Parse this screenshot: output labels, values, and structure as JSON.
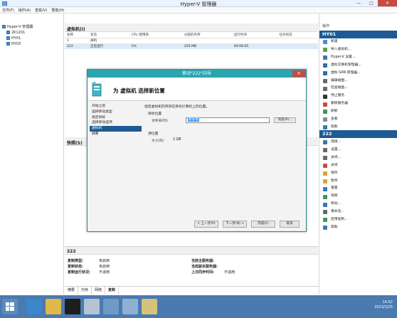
{
  "window": {
    "title": "Hyper-V 管理器",
    "min": "—",
    "max": "□",
    "close": "✕"
  },
  "menu": [
    "文件(F)",
    "操作(A)",
    "查看(V)",
    "帮助(H)"
  ],
  "tree": {
    "root": "Hyper-V 管理器",
    "hosts": [
      "2K1201",
      "HY01",
      "HY03"
    ]
  },
  "vms": {
    "title": "虚拟机(I)",
    "columns": [
      "名称",
      "状态",
      "CPU 使用率",
      "分配的内存",
      "运行时间",
      "任务状态"
    ],
    "rows": [
      [
        "1",
        "关机",
        "",
        "",
        "",
        ""
      ],
      [
        "222",
        "正在运行",
        "1%",
        "256 MB",
        "00:08:05",
        ""
      ]
    ]
  },
  "snapshots": {
    "title": "快照(S)"
  },
  "details": {
    "title": "222",
    "left_keys": [
      "复制类型:",
      "复制状态:",
      "复制运行状况:"
    ],
    "left_values": [
      "未启用",
      "未启用",
      "不适用"
    ],
    "right_keys": [
      "当前主服务器:",
      "当前副本服务器:",
      "上次同步时间:"
    ],
    "right_values": [
      "",
      "",
      "不适用"
    ],
    "tabs": [
      "摘要",
      "内存",
      "网络",
      "复制"
    ]
  },
  "actions": {
    "title": "操作",
    "host_section": "HY01",
    "host_items": [
      "新建",
      "导入虚拟机...",
      "Hyper-V 设置...",
      "虚拟交换机管理器...",
      "虚拟 SAN 管理器...",
      "编辑磁盘...",
      "检查磁盘...",
      "停止服务",
      "删除服务器",
      "刷新",
      "查看",
      "帮助"
    ],
    "vm_section": "222",
    "vm_items": [
      "连接...",
      "设置...",
      "关闭...",
      "关闭",
      "保存",
      "暂停",
      "重置",
      "快照",
      "移动...",
      "重命名...",
      "启用复制...",
      "帮助"
    ]
  },
  "wizard": {
    "title": "移动\"222\"向导",
    "close": "✕",
    "heading": "为 虚拟机 选择新位置",
    "steps": [
      "开始之前",
      "选择移动类型",
      "指定目标",
      "选择移动选项",
      "虚拟机",
      "摘要"
    ],
    "current_step": 4,
    "instruction": "指定虚拟机的项目在目标计算机上的位置。",
    "target_label": "目标位置",
    "folder_label": "文件夹(O):",
    "folder_value": "新加卷",
    "browse": "浏览(R)...",
    "source_label": "源位置",
    "size_label": "大小(S):",
    "size_value": "2 GB",
    "buttons": {
      "prev": "< 上一步(P)",
      "next": "下一步(N) >",
      "finish": "完成(F)",
      "cancel": "取消"
    }
  },
  "taskbar": {
    "time": "14:52",
    "date": "2013/3/25"
  },
  "colors": {
    "wizard_title": "#29a6b0",
    "section_blue": "#1e5a94",
    "taskbar": "#4a7ab0",
    "close_red": "#c74b3f"
  }
}
